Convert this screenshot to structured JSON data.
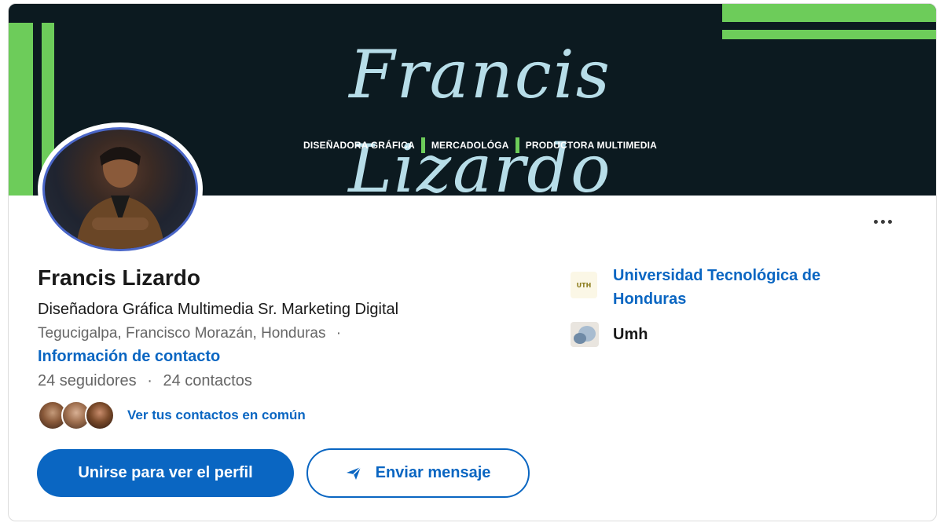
{
  "banner": {
    "title": "Francis Lizardo",
    "tag1": "DISEÑADORA GRÁFICA",
    "tag2": "MERCADOLÓGA",
    "tag3": "PRODUCTORA MULTIMEDIA",
    "accent_color": "#6dcc5a",
    "background_color": "#0c1a20"
  },
  "profile": {
    "name": "Francis Lizardo",
    "headline": "Diseñadora Gráfica Multimedia Sr. Marketing Digital",
    "location": "Tegucigalpa, Francisco Morazán, Honduras",
    "location_separator": "·",
    "contact_info_label": "Información de contacto",
    "followers": "24 seguidores",
    "stats_separator": "·",
    "connections": "24 contactos",
    "mutual_label": "Ver tus contactos en común"
  },
  "actions": {
    "join_label": "Unirse para ver el perfil",
    "message_label": "Enviar mensaje",
    "message_icon": "send-icon",
    "more_icon": "more-options-icon"
  },
  "education": {
    "school": "Universidad Tecnológica de Honduras",
    "school_logo_text": "UTH"
  },
  "organization": {
    "name": "Umh"
  },
  "colors": {
    "link": "#0a66c2",
    "primary_button": "#0a66c2"
  }
}
